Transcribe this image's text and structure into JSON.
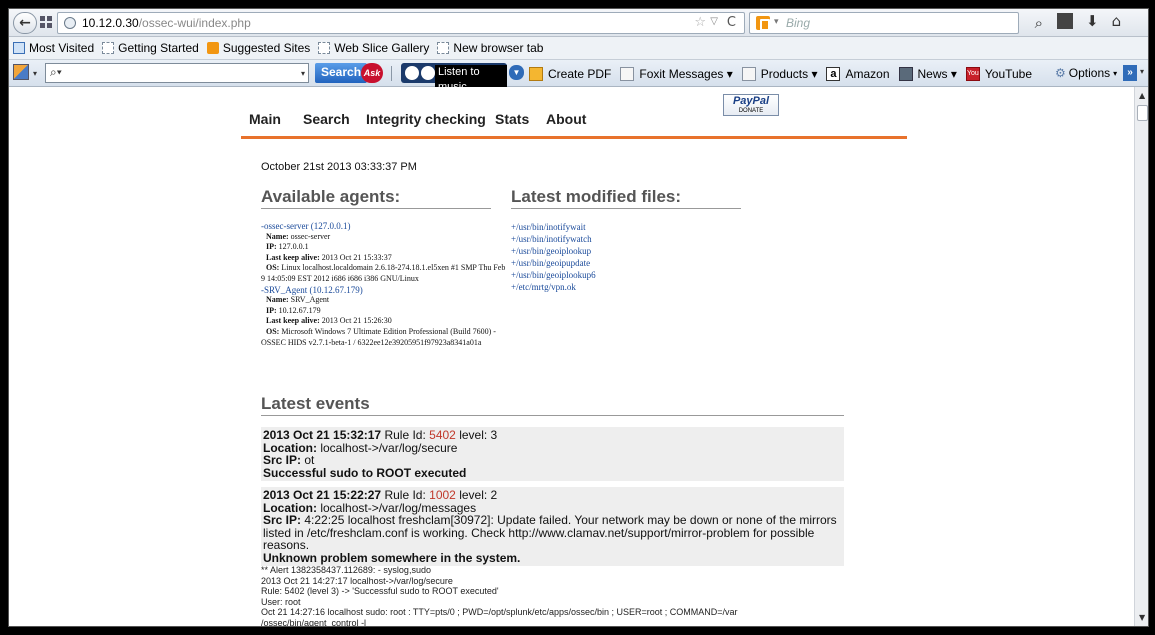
{
  "browser": {
    "url_host": "10.12.0.30",
    "url_path": "/ossec-wui/index.php",
    "search_engine_placeholder": "Bing"
  },
  "bookmarks": [
    {
      "label": "Most Visited",
      "icon": "ie-icon"
    },
    {
      "label": "Getting Started",
      "icon": "bookmark-icon"
    },
    {
      "label": "Suggested Sites",
      "icon": "suggested-sites-icon"
    },
    {
      "label": "Web Slice Gallery",
      "icon": "bookmark-icon"
    },
    {
      "label": "New browser tab",
      "icon": "bookmark-icon"
    }
  ],
  "toolbar": {
    "search_button": "Search",
    "ask_logo": "Ask",
    "music_label": "Listen to music",
    "items": [
      {
        "label": "Create PDF",
        "icon": "pdf-icon"
      },
      {
        "label": "Foxit Messages ▾",
        "icon": "foxit-icon"
      },
      {
        "label": "Products ▾",
        "icon": "products-icon"
      },
      {
        "label": "Amazon",
        "icon": "amazon-icon"
      },
      {
        "label": "News ▾",
        "icon": "news-icon"
      },
      {
        "label": "YouTube",
        "icon": "youtube-icon"
      }
    ],
    "options_label": "Options"
  },
  "nav": {
    "tabs": [
      "Main",
      "Search",
      "Integrity checking",
      "Stats",
      "About"
    ],
    "paypal_top": "PayPal",
    "paypal_bottom": "DONATE"
  },
  "timestamp": "October 21st 2013 03:33:37 PM",
  "agents": {
    "heading": "Available agents:",
    "list": [
      {
        "link": "-ossec-server (127.0.0.1)",
        "name_label": "Name:",
        "name": "ossec-server",
        "ip_label": "IP:",
        "ip": "127.0.0.1",
        "keep_label": "Last keep alive:",
        "keep": "2013 Oct 21 15:33:37",
        "os_label": "OS:",
        "os": "Linux localhost.localdomain 2.6.18-274.18.1.el5xen #1 SMP Thu Feb 9 14:05:09 EST 2012 i686 i686 i386 GNU/Linux"
      },
      {
        "link": "-SRV_Agent (10.12.67.179)",
        "name_label": "Name:",
        "name": "SRV_Agent",
        "ip_label": "IP:",
        "ip": "10.12.67.179",
        "keep_label": "Last keep alive:",
        "keep": "2013 Oct 21 15:26:30",
        "os_label": "OS:",
        "os": "Microsoft Windows 7 Ultimate Edition Professional (Build 7600) - OSSEC HIDS v2.7.1-beta-1 / 6322ee12e39205951f97923a8341a01a"
      }
    ]
  },
  "files": {
    "heading": "Latest modified files:",
    "list": [
      "+/usr/bin/inotifywait",
      "+/usr/bin/inotifywatch",
      "+/usr/bin/geoiplookup",
      "+/usr/bin/geoipupdate",
      "+/usr/bin/geoiplookup6",
      "+/etc/mrtg/vpn.ok"
    ]
  },
  "events": {
    "heading": "Latest events",
    "list": [
      {
        "datetime": "2013 Oct 21 15:32:17",
        "rule_label": "Rule Id:",
        "rule_id": "5402",
        "level_label": "level:",
        "level": "3",
        "location_label": "Location:",
        "location": "localhost->/var/log/secure",
        "srcip_label": "Src IP:",
        "srcip": "ot",
        "description": "Successful sudo to ROOT executed"
      },
      {
        "datetime": "2013 Oct 21 15:22:27",
        "rule_label": "Rule Id:",
        "rule_id": "1002",
        "level_label": "level:",
        "level": "2",
        "location_label": "Location:",
        "location": "localhost->/var/log/messages",
        "srcip_label": "Src IP:",
        "srcip": "4:22:25 localhost freshclam[30972]: Update failed. Your network may be down or none of the mirrors listed in /etc/freshclam.conf is working. Check http://www.clamav.net/support/mirror-problem for possible reasons.",
        "description": "Unknown problem somewhere in the system."
      }
    ],
    "raw_log": [
      "** Alert 1382358437.112689: - syslog,sudo",
      "2013 Oct 21 14:27:17 localhost->/var/log/secure",
      "Rule: 5402 (level 3) -> 'Successful sudo to ROOT executed'",
      "User: root",
      "Oct 21 14:27:16 localhost sudo: root : TTY=pts/0 ; PWD=/opt/splunk/etc/apps/ossec/bin ; USER=root ; COMMAND=/var",
      "/ossec/bin/agent_control -l"
    ]
  },
  "colors": {
    "accent": "#e8722c",
    "rule_id": "#c0392b",
    "link": "#1a4a9a"
  }
}
